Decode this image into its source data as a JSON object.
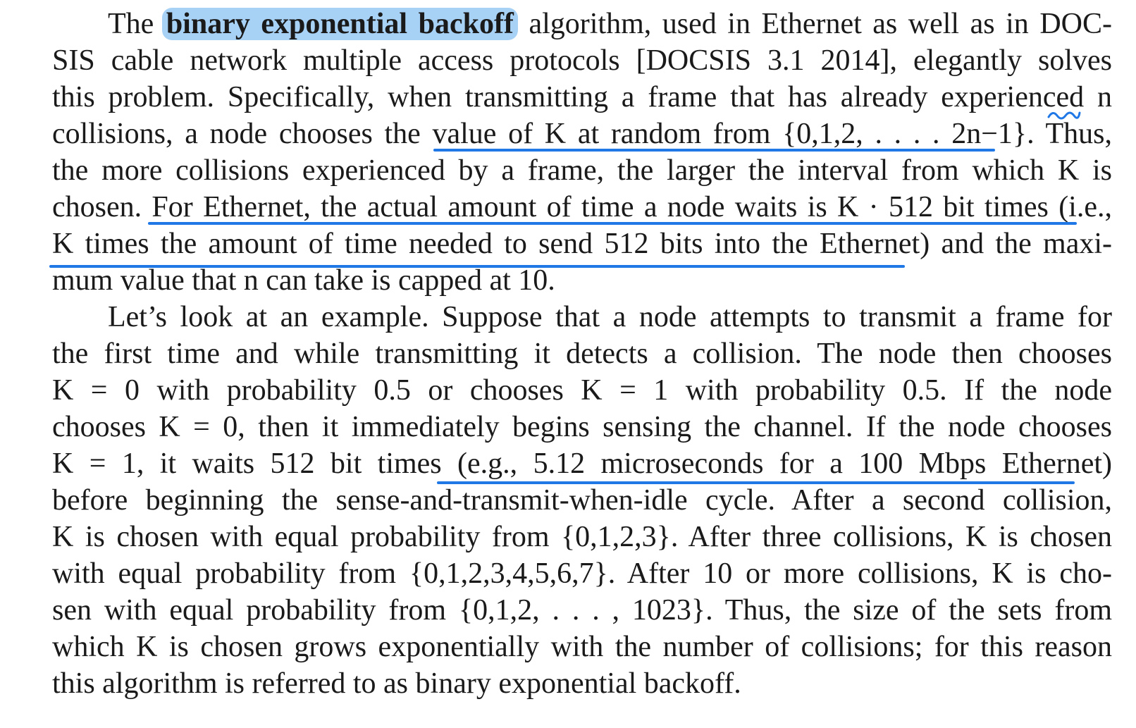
{
  "paragraph1": {
    "highlight_term": "binary exponential backoff",
    "lines": [
      "algorithm, used in Ethernet as well as in DOC-",
      "SIS cable network multiple access protocols [DOCSIS 3.1 2014], elegantly solves",
      "this problem. Specifically, when transmitting a frame that has already experienced n",
      "collisions, a node chooses the value of K at random from {0,1,2, . . . . 2n−1}. Thus,",
      "the more collisions experienced by a frame, the larger the interval from which K is",
      "chosen. For Ethernet, the actual amount of time a node waits is K · 512 bit times (i.e.,",
      "K times the amount of time needed to send 512 bits into the Ethernet) and the maxi-",
      "mum value that n can take is capped at 10."
    ],
    "first_word": "The"
  },
  "paragraph2": {
    "lines": [
      "Let’s look at an example. Suppose that a node attempts to transmit a frame for",
      "the first time and while transmitting it detects a collision. The node then chooses",
      "K = 0 with probability 0.5 or chooses K = 1 with probability 0.5. If the node",
      "chooses K = 0, then it immediately begins sensing the channel. If the node chooses",
      "K = 1, it waits 512 bit times (e.g., 5.12 microseconds for a 100 Mbps Ethernet)",
      "before beginning the sense-and-transmit-when-idle cycle. After a second collision,",
      "K is chosen with equal probability from {0,1,2,3}. After three collisions, K is chosen",
      "with equal probability from {0,1,2,3,4,5,6,7}. After 10 or more collisions, K is cho-",
      "sen with equal probability from {0,1,2, . . . , 1023}. Thus, the size of the sets from",
      "which K is chosen grows exponentially with the number of collisions; for this reason",
      "this algorithm is referred to as binary exponential backoff."
    ]
  },
  "annotation_colors": {
    "highlight": "#a8d2f5",
    "underline": "#1f78e6"
  }
}
